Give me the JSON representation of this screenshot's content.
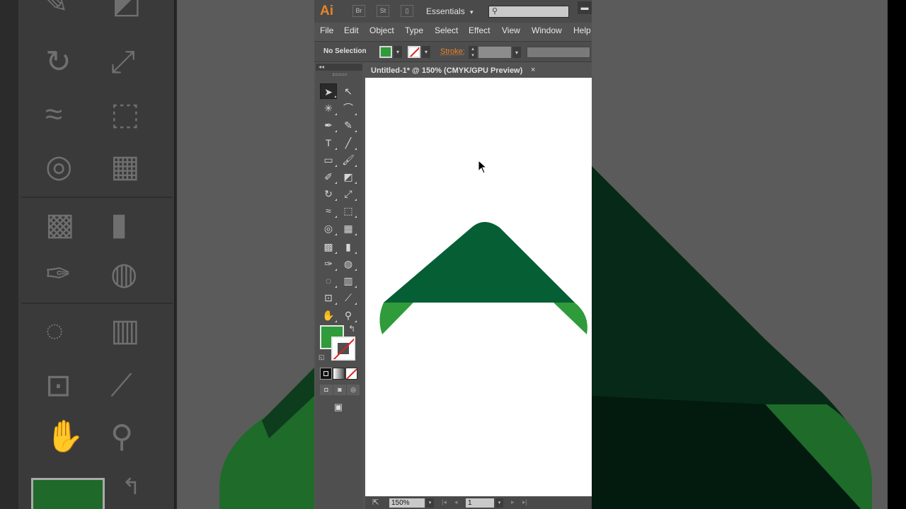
{
  "app": {
    "logo": "Ai",
    "bridge_button": "Br",
    "stock_button": "St",
    "workspace": "Essentials",
    "workspace_caret": "▾",
    "search_placeholder": "",
    "window_button": "▬"
  },
  "menu": [
    "File",
    "Edit",
    "Object",
    "Type",
    "Select",
    "Effect",
    "View",
    "Window",
    "Help"
  ],
  "control_bar": {
    "selection_status": "No Selection",
    "stroke_label": "Stroke:",
    "stroke_weight": "",
    "fill_color": "#2f9b3a"
  },
  "toolbar": {
    "collapse": "◂◂",
    "tools": [
      {
        "name": "selection-tool",
        "glyph": "➤"
      },
      {
        "name": "direct-selection-tool",
        "glyph": "↖"
      },
      {
        "name": "magic-wand-tool",
        "glyph": "✳"
      },
      {
        "name": "lasso-tool",
        "glyph": "⌒"
      },
      {
        "name": "pen-tool",
        "glyph": "✒"
      },
      {
        "name": "curvature-tool",
        "glyph": "✎"
      },
      {
        "name": "type-tool",
        "glyph": "T"
      },
      {
        "name": "line-segment-tool",
        "glyph": "╱"
      },
      {
        "name": "rectangle-tool",
        "glyph": "▭"
      },
      {
        "name": "paintbrush-tool",
        "glyph": "🖌"
      },
      {
        "name": "shaper-tool",
        "glyph": "✐"
      },
      {
        "name": "eraser-tool",
        "glyph": "◩"
      },
      {
        "name": "rotate-tool",
        "glyph": "↻"
      },
      {
        "name": "scale-tool",
        "glyph": "⤢"
      },
      {
        "name": "width-tool",
        "glyph": "≈"
      },
      {
        "name": "free-transform-tool",
        "glyph": "⬚"
      },
      {
        "name": "shape-builder-tool",
        "glyph": "◎"
      },
      {
        "name": "perspective-grid-tool",
        "glyph": "▦"
      },
      {
        "name": "mesh-tool",
        "glyph": "▩"
      },
      {
        "name": "gradient-tool",
        "glyph": "▮"
      },
      {
        "name": "eyedropper-tool",
        "glyph": "✑"
      },
      {
        "name": "blend-tool",
        "glyph": "◍"
      },
      {
        "name": "symbol-sprayer-tool",
        "glyph": "◌"
      },
      {
        "name": "column-graph-tool",
        "glyph": "▥"
      },
      {
        "name": "artboard-tool",
        "glyph": "⊡"
      },
      {
        "name": "slice-tool",
        "glyph": "⟋"
      },
      {
        "name": "hand-tool",
        "glyph": "✋"
      },
      {
        "name": "zoom-tool",
        "glyph": "⚲"
      }
    ],
    "swap_glyph": "↰",
    "default_glyph": "◱",
    "screen_mode_glyph": "▣"
  },
  "document": {
    "tab_title": "Untitled-1* @ 150% (CMYK/GPU Preview)",
    "close": "×",
    "dark_green": "#055e34",
    "light_green": "#2f9b3a"
  },
  "status_bar": {
    "zoom": "150%",
    "page": "1",
    "caret": "▾",
    "first": "|◂",
    "prev": "◂",
    "next": "▸",
    "last": "▸|"
  }
}
